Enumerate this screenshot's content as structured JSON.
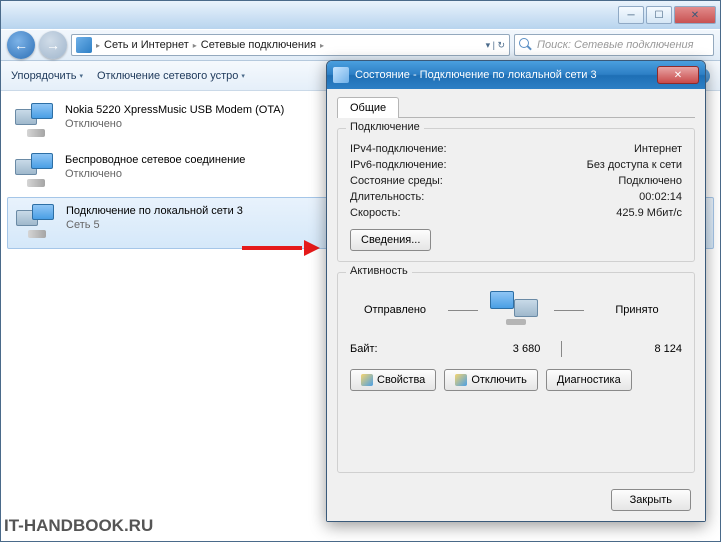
{
  "window": {
    "breadcrumb": {
      "level1": "Сеть и Интернет",
      "level2": "Сетевые подключения"
    },
    "search_placeholder": "Поиск: Сетевые подключения"
  },
  "toolbar": {
    "organize": "Упорядочить",
    "disable": "Отключение сетевого устро"
  },
  "connections": [
    {
      "name": "Nokia 5220 XpressMusic USB Modem (OTA)",
      "status": "Отключено"
    },
    {
      "name": "Беспроводное сетевое соединение",
      "status": "Отключено"
    },
    {
      "name": "Подключение по локальной сети 3",
      "status": "Сеть  5"
    }
  ],
  "dialog": {
    "title": "Состояние - Подключение по локальной сети 3",
    "tab": "Общие",
    "group_conn": "Подключение",
    "rows": {
      "ipv4_k": "IPv4-подключение:",
      "ipv4_v": "Интернет",
      "ipv6_k": "IPv6-подключение:",
      "ipv6_v": "Без доступа к сети",
      "media_k": "Состояние среды:",
      "media_v": "Подключено",
      "dur_k": "Длительность:",
      "dur_v": "00:02:14",
      "speed_k": "Скорость:",
      "speed_v": "425.9 Мбит/с"
    },
    "details_btn": "Сведения...",
    "group_act": "Активность",
    "sent": "Отправлено",
    "recv": "Принято",
    "bytes_label": "Байт:",
    "bytes_sent": "3 680",
    "bytes_recv": "8 124",
    "btn_props": "Свойства",
    "btn_disable": "Отключить",
    "btn_diag": "Диагностика",
    "btn_close": "Закрыть"
  },
  "watermark": "IT-HANDBOOK.RU"
}
